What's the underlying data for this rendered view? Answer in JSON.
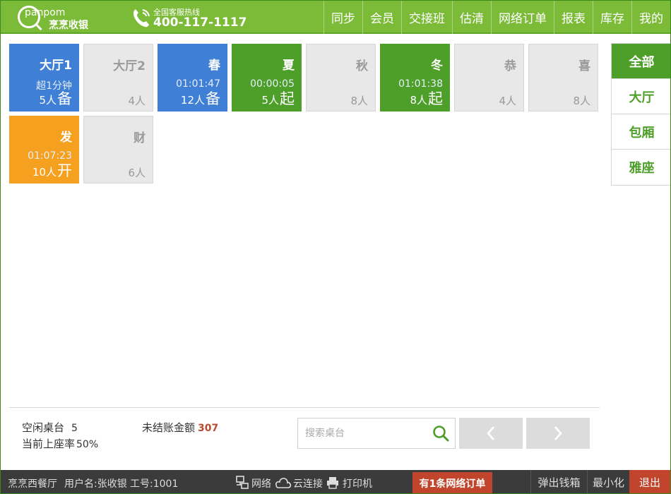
{
  "brand": {
    "logo_text": "panpom",
    "logo_cn": "烹烹收银",
    "hotline_label": "全国客服热线",
    "hotline_number": "400-117-1117"
  },
  "nav": [
    "同步",
    "会员",
    "交接班",
    "估清",
    "网络订单",
    "报表",
    "库存",
    "我的"
  ],
  "tables": [
    {
      "name": "大厅1",
      "time": "超1分钟",
      "people": "5人",
      "state": "备",
      "status": "blue"
    },
    {
      "name": "大厅2",
      "time": "",
      "people": "4人",
      "state": "",
      "status": "idle"
    },
    {
      "name": "春",
      "time": "01:01:47",
      "people": "12人",
      "state": "备",
      "status": "blue"
    },
    {
      "name": "夏",
      "time": "00:00:05",
      "people": "5人",
      "state": "起",
      "status": "green"
    },
    {
      "name": "秋",
      "time": "",
      "people": "8人",
      "state": "",
      "status": "idle"
    },
    {
      "name": "冬",
      "time": "01:01:38",
      "people": "8人",
      "state": "起",
      "status": "green"
    },
    {
      "name": "恭",
      "time": "",
      "people": "4人",
      "state": "",
      "status": "idle"
    },
    {
      "name": "喜",
      "time": "",
      "people": "8人",
      "state": "",
      "status": "idle"
    },
    {
      "name": "发",
      "time": "01:07:23",
      "people": "10人",
      "state": "开",
      "status": "orange"
    },
    {
      "name": "财",
      "time": "",
      "people": "6人",
      "state": "",
      "status": "idle"
    }
  ],
  "categories": [
    {
      "label": "全部",
      "active": true
    },
    {
      "label": "大厅",
      "active": false
    },
    {
      "label": "包厢",
      "active": false
    },
    {
      "label": "雅座",
      "active": false
    }
  ],
  "stats": {
    "idle_label": "空闲桌台",
    "idle_value": "5",
    "occupancy_label": "当前上座率",
    "occupancy_value": "50%",
    "unpaid_label": "未结账金额",
    "unpaid_value": "307"
  },
  "search": {
    "placeholder": "搜索桌台",
    "value": ""
  },
  "statusbar": {
    "restaurant": "烹烹西餐厅",
    "user": "用户名:张收银",
    "employee_id": "工号:1001",
    "network": "网络",
    "cloud": "云连接",
    "printer": "打印机",
    "alert": "有1条网络订单",
    "cash_drawer": "弹出钱箱",
    "minimize": "最小化",
    "exit": "退出"
  },
  "colors": {
    "header_green": "#7cbb38",
    "busy_blue": "#3f7fd6",
    "busy_green": "#4e9e2a",
    "busy_orange": "#f6a020",
    "idle_gray": "#e8e8e8",
    "alert_red": "#c0452c",
    "statusbar_dark": "#3b3b3b"
  }
}
